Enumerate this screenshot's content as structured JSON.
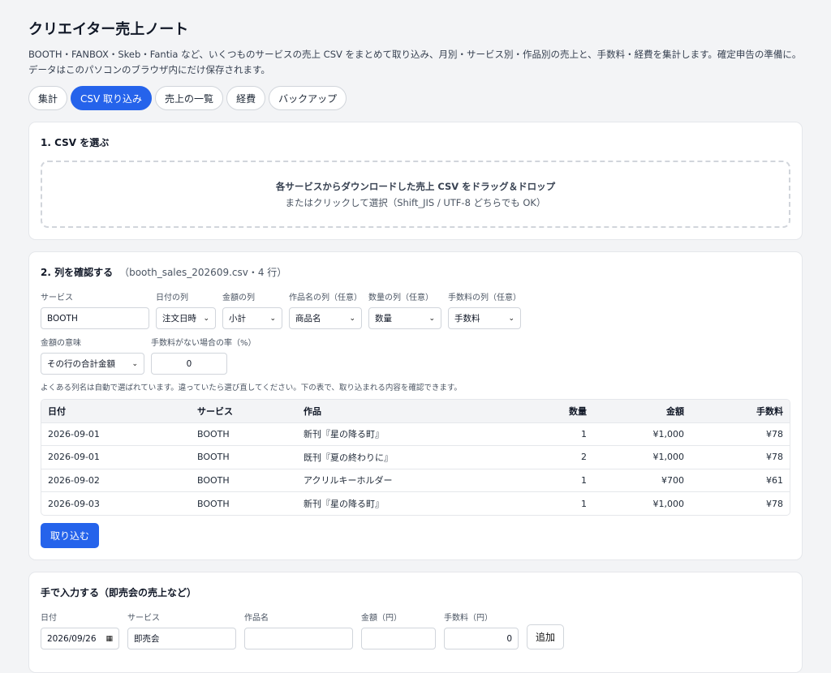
{
  "app": {
    "title": "クリエイター売上ノート",
    "description": "BOOTH・FANBOX・Skeb・Fantia など、いくつものサービスの売上 CSV をまとめて取り込み、月別・サービス別・作品別の売上と、手数料・経費を集計します。確定申告の準備に。データはこのパソコンのブラウザ内にだけ保存されます。"
  },
  "tabs": [
    {
      "label": "集計",
      "active": false
    },
    {
      "label": "CSV 取り込み",
      "active": true
    },
    {
      "label": "売上の一覧",
      "active": false
    },
    {
      "label": "経費",
      "active": false
    },
    {
      "label": "バックアップ",
      "active": false
    }
  ],
  "step1": {
    "title": "1. CSV を選ぶ",
    "drop_line1": "各サービスからダウンロードした売上 CSV をドラッグ＆ドロップ",
    "drop_line2": "またはクリックして選択（Shift_JIS / UTF-8 どちらでも OK）"
  },
  "step2": {
    "title": "2. 列を確認する",
    "file_info": "（booth_sales_202609.csv・4 行）",
    "service_label": "サービス",
    "service_value": "BOOTH",
    "date_col_label": "日付の列",
    "date_col_value": "注文日時",
    "amount_col_label": "金額の列",
    "amount_col_value": "小計",
    "title_col_label": "作品名の列（任意）",
    "title_col_value": "商品名",
    "qty_col_label": "数量の列（任意）",
    "qty_col_value": "数量",
    "fee_col_label": "手数料の列（任意）",
    "fee_col_value": "手数料",
    "amount_meaning_label": "金額の意味",
    "amount_meaning_value": "その行の合計金額",
    "fee_rate_label": "手数料がない場合の率（%）",
    "fee_rate_value": "0",
    "hint": "よくある列名は自動で選ばれています。違っていたら選び直してください。下の表で、取り込まれる内容を確認できます。",
    "table": {
      "headers": [
        "日付",
        "サービス",
        "作品",
        "数量",
        "金額",
        "手数料"
      ],
      "rows": [
        [
          "2026-09-01",
          "BOOTH",
          "新刊『星の降る町』",
          "1",
          "¥1,000",
          "¥78"
        ],
        [
          "2026-09-01",
          "BOOTH",
          "既刊『夏の終わりに』",
          "2",
          "¥1,000",
          "¥78"
        ],
        [
          "2026-09-02",
          "BOOTH",
          "アクリルキーホルダー",
          "1",
          "¥700",
          "¥61"
        ],
        [
          "2026-09-03",
          "BOOTH",
          "新刊『星の降る町』",
          "1",
          "¥1,000",
          "¥78"
        ]
      ]
    },
    "import_button": "取り込む"
  },
  "manual": {
    "title": "手で入力する（即売会の売上など）",
    "date_label": "日付",
    "date_value": "2026/09/26",
    "service_label": "サービス",
    "service_value": "即売会",
    "title_label": "作品名",
    "amount_label": "金額（円）",
    "fee_label": "手数料（円）",
    "fee_value": "0",
    "add_button": "追加"
  }
}
